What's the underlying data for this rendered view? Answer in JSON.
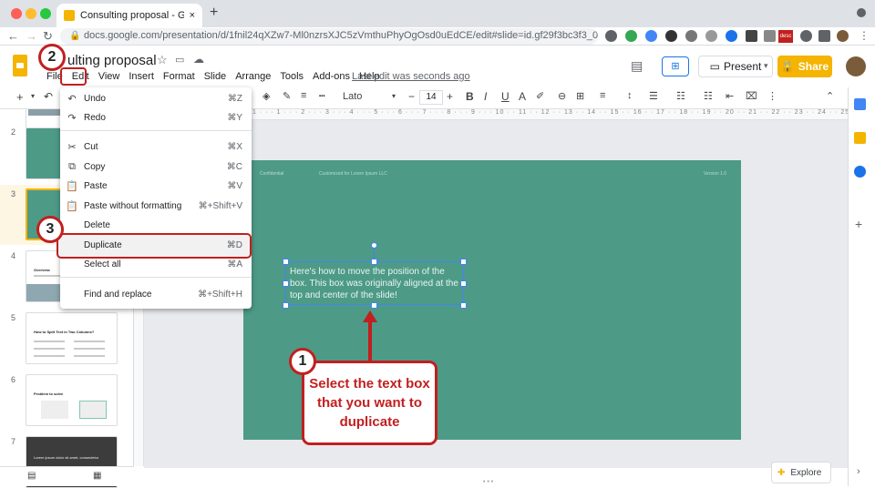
{
  "browser": {
    "tab_title": "Consulting proposal - Google S",
    "new_tab": "+",
    "url": "docs.google.com/presentation/d/1fnil24qXZw7-Ml0nzrsXJC5zVmthuPhyOgOsd0uEdCE/edit#slide=id.gf29f3bc3f3_0_15",
    "ext_label": "desc"
  },
  "doc": {
    "title": "ulting proposal",
    "menus": [
      "File",
      "Edit",
      "View",
      "Insert",
      "Format",
      "Slide",
      "Arrange",
      "Tools",
      "Add-ons",
      "Help"
    ],
    "last_edit": "Last edit was seconds ago",
    "present": "Present",
    "share": "Share"
  },
  "toolbar": {
    "font": "Lato",
    "size": "14"
  },
  "ruler": "1 · · · 1 · · · 2 · · · 3 · · · 4 · · · 5 · · · 6 · · · 7 · · · 8 · · · 9 · · · 10 · · 11 · · 12 · · 13 · · 14 · · 15 · · 16 · · 17 · · 18 · · 19 · · 20 · · 21 · · 22 · · 23 · · 24 · · 25",
  "filmstrip": {
    "numbers": [
      "2",
      "3",
      "4",
      "5",
      "6",
      "7"
    ],
    "slide4_title": "Overview",
    "slide5_title": "How to Split Text in Two Columns?",
    "slide6_title": "Problem to solve",
    "slide7_title": "Lorem ipsum dolor sit amet, consectetur"
  },
  "slide": {
    "header_left": "Confidential",
    "header_mid": "Customized for Lorem Ipsum LLC",
    "header_right": "Version 1.0",
    "textbox": "Here's how to move the position of the box. This box was originally aligned at the top and center of the slide!"
  },
  "edit_menu": [
    {
      "icon": "↶",
      "label": "Undo",
      "shortcut": "⌘Z"
    },
    {
      "icon": "↷",
      "label": "Redo",
      "shortcut": "⌘Y"
    },
    {
      "icon": "✂",
      "label": "Cut",
      "shortcut": "⌘X"
    },
    {
      "icon": "⧉",
      "label": "Copy",
      "shortcut": "⌘C"
    },
    {
      "icon": "📋",
      "label": "Paste",
      "shortcut": "⌘V"
    },
    {
      "icon": "📋",
      "label": "Paste without formatting",
      "shortcut": "⌘+Shift+V"
    },
    {
      "icon": "",
      "label": "Delete",
      "shortcut": ""
    },
    {
      "icon": "",
      "label": "Duplicate",
      "shortcut": "⌘D"
    },
    {
      "icon": "",
      "label": "Select all",
      "shortcut": "⌘A"
    },
    {
      "icon": "",
      "label": "Find and replace",
      "shortcut": "⌘+Shift+H"
    }
  ],
  "annotations": {
    "step1": "1",
    "step2": "2",
    "step3": "3",
    "callout": "Select the text box that you want to duplicate"
  },
  "explore": "Explore",
  "colors": {
    "accent": "#c21f1f",
    "slide_bg": "#4d9a87",
    "share": "#f4b400"
  }
}
